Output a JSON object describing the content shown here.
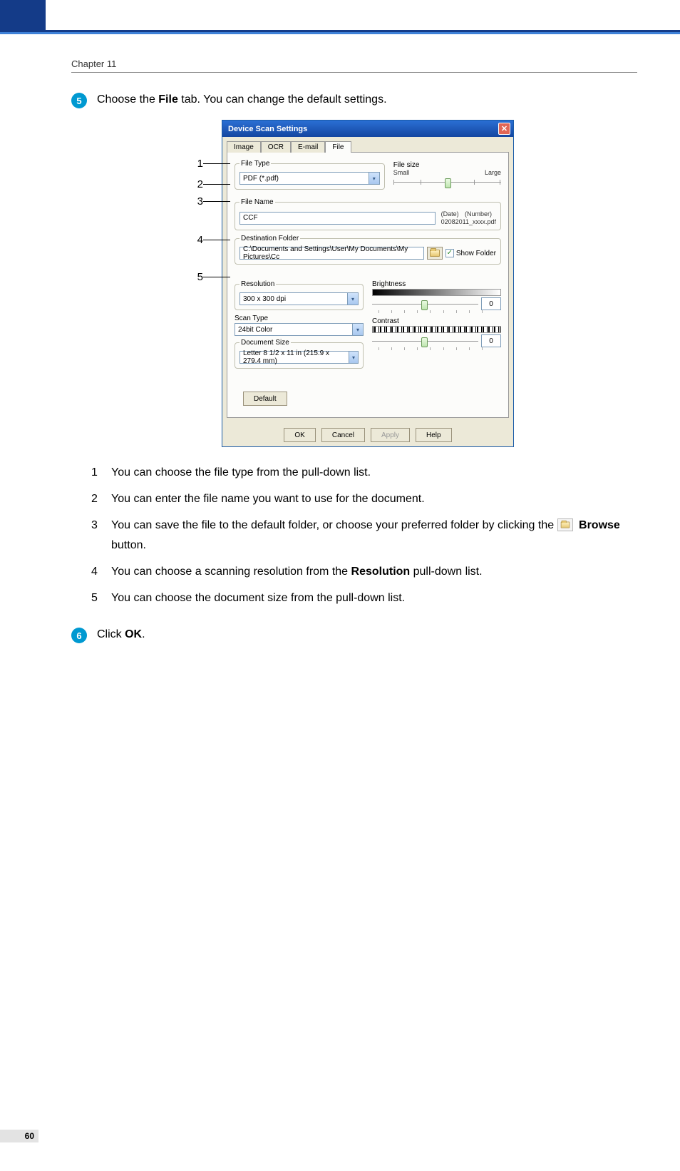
{
  "chapter": "Chapter 11",
  "step5": {
    "num": "5",
    "pre": "Choose the ",
    "bold": "File",
    "post": " tab. You can change the default settings."
  },
  "step6": {
    "num": "6",
    "pre": "Click ",
    "bold": "OK",
    "post": "."
  },
  "dialog": {
    "title": "Device Scan Settings",
    "tabs": {
      "image": "Image",
      "ocr": "OCR",
      "email": "E-mail",
      "file": "File"
    },
    "file_type_label": "File Type",
    "file_type_value": "PDF (*.pdf)",
    "file_size_label": "File size",
    "file_size_small": "Small",
    "file_size_large": "Large",
    "file_name_label": "File Name",
    "file_name_value": "CCF",
    "date_label": "(Date)",
    "number_label": "(Number)",
    "filename_suffix": "02082011_xxxx.pdf",
    "dest_folder_label": "Destination Folder",
    "dest_folder_value": "C:\\Documents and Settings\\User\\My Documents\\My Pictures\\Cc",
    "show_folder": "Show Folder",
    "resolution_label": "Resolution",
    "resolution_value": "300 x 300 dpi",
    "scan_type_label": "Scan Type",
    "scan_type_value": "24bit Color",
    "doc_size_label": "Document Size",
    "doc_size_value": "Letter 8 1/2 x 11 in (215.9 x 279.4 mm)",
    "brightness_label": "Brightness",
    "brightness_value": "0",
    "contrast_label": "Contrast",
    "contrast_value": "0",
    "default_btn": "Default",
    "ok": "OK",
    "cancel": "Cancel",
    "apply": "Apply",
    "help": "Help"
  },
  "callouts": {
    "c1": "1",
    "c2": "2",
    "c3": "3",
    "c4": "4",
    "c5": "5"
  },
  "list": {
    "i1": {
      "n": "1",
      "t": "You can choose the file type from the pull-down list."
    },
    "i2": {
      "n": "2",
      "t": "You can enter the file name you want to use for the document."
    },
    "i3": {
      "n": "3",
      "pre": "You can save the file to the default folder, or choose your preferred folder by clicking the ",
      "bold": "Browse",
      "post": " button."
    },
    "i4": {
      "n": "4",
      "pre": "You can choose a scanning resolution from the ",
      "bold": "Resolution",
      "post": " pull-down list."
    },
    "i5": {
      "n": "5",
      "t": "You can choose the document size from the pull-down list."
    }
  },
  "page_number": "60"
}
